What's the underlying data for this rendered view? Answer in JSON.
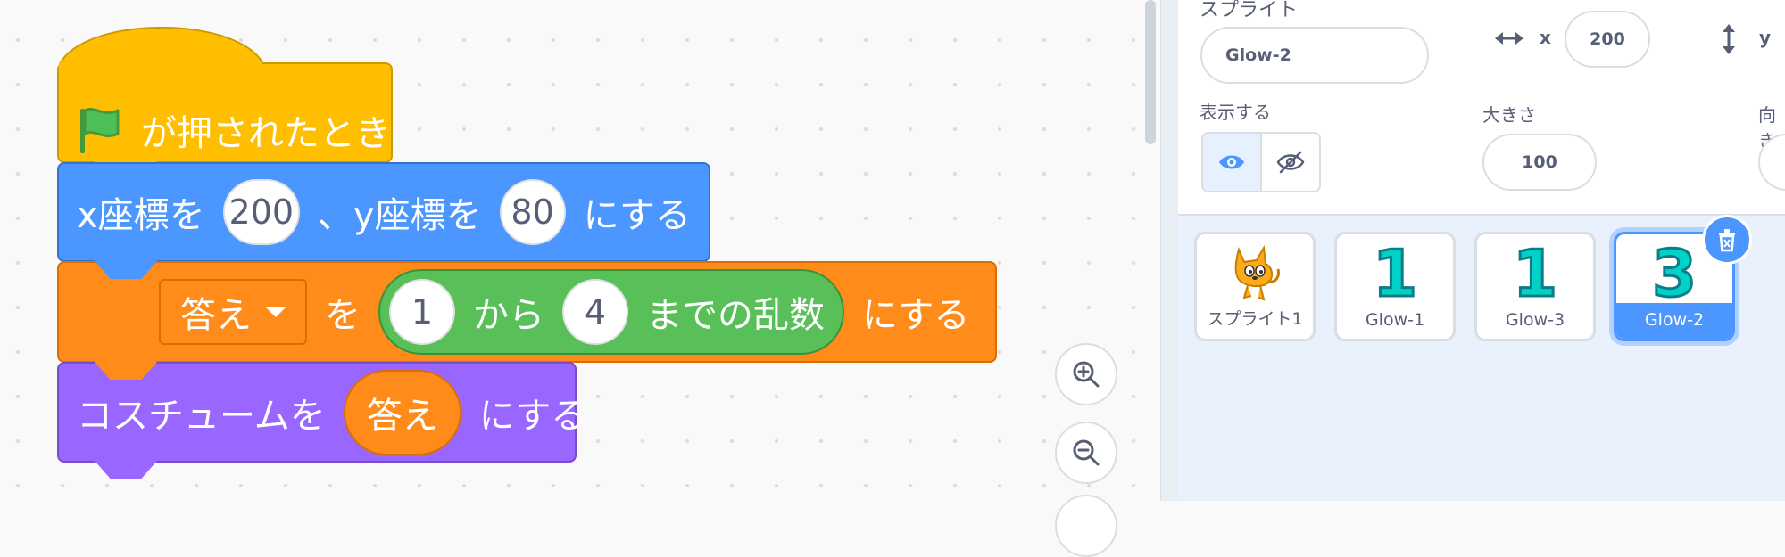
{
  "code_area": {
    "hat_block": {
      "label": "が押されたとき",
      "icon": "green-flag-icon"
    },
    "motion_block": {
      "part1": "x座標を",
      "x_value": "200",
      "part2": "、y座標を",
      "y_value": "80",
      "part3": "にする"
    },
    "variable_block": {
      "variable_dropdown": "答え",
      "part1": "を",
      "random": {
        "from": "1",
        "from_label": "から",
        "to": "4",
        "to_label": "までの乱数"
      },
      "part2": "にする"
    },
    "looks_block": {
      "part1": "コスチュームを",
      "reporter": "答え",
      "part2": "にする"
    },
    "zoom_in_icon": "zoom-in-icon",
    "zoom_out_icon": "zoom-out-icon"
  },
  "sprite_info": {
    "sprite_label": "スプライト",
    "sprite_name": "Glow-2",
    "x_label": "x",
    "x_value": "200",
    "y_label": "y",
    "show_label": "表示する",
    "size_label": "大きさ",
    "size_value": "100",
    "direction_label": "向き",
    "colors": {
      "accent": "#4c97ff",
      "text": "#575e75"
    }
  },
  "sprite_list": {
    "items": [
      {
        "name": "スプライト1",
        "thumb": "cat"
      },
      {
        "name": "Glow-1",
        "thumb": "1"
      },
      {
        "name": "Glow-3",
        "thumb": "1"
      },
      {
        "name": "Glow-2",
        "thumb": "3",
        "selected": true
      }
    ],
    "delete_icon": "trash-icon"
  }
}
